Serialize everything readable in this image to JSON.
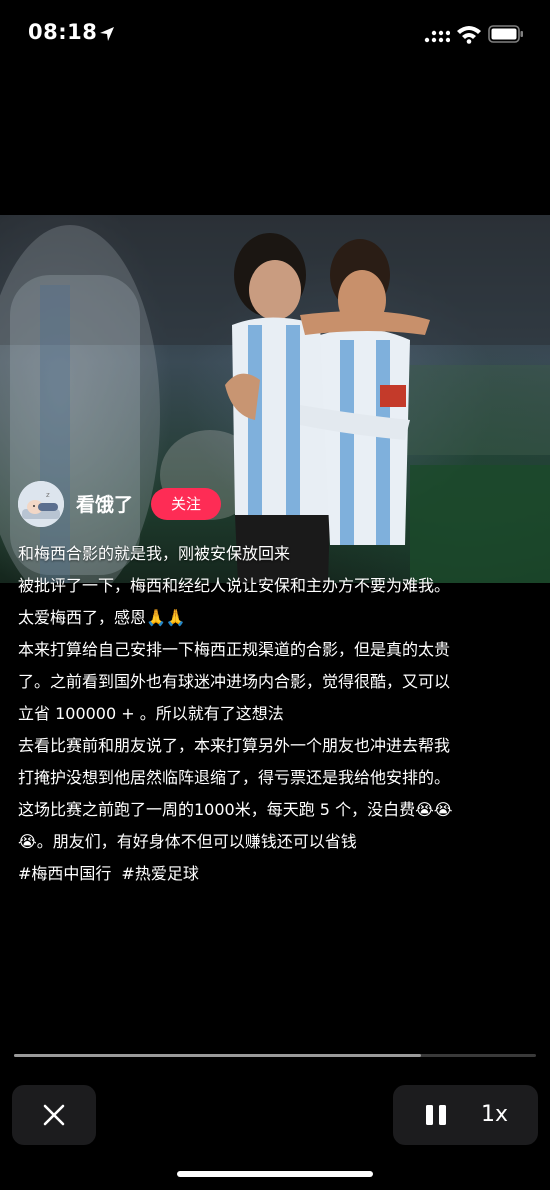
{
  "status_bar": {
    "time": "08:18",
    "icons": [
      "location-arrow-icon",
      "cellular-signal-icon",
      "wifi-icon",
      "battery-icon"
    ]
  },
  "author": {
    "name": "看饿了",
    "follow_label": "关注"
  },
  "caption": {
    "lines": [
      "和梅西合影的就是我，刚被安保放回来",
      "被批评了一下，梅西和经纪人说让安保和主办方不要为难我。",
      "太爱梅西了，感恩🙏🙏",
      "本来打算给自己安排一下梅西正规渠道的合影，但是真的太贵",
      "了。之前看到国外也有球迷冲进场内合影，觉得很酷，又可以",
      "立省 100000 + 。所以就有了这想法",
      "去看比赛前和朋友说了，本来打算另外一个朋友也冲进去帮我",
      "打掩护没想到他居然临阵退缩了，得亏票还是我给他安排的。",
      "这场比赛之前跑了一周的1000米，每天跑 5 个，没白费😭😭",
      "😭。朋友们，有好身体不但可以赚钱还可以省钱"
    ],
    "hashtags": [
      "#梅西中国行",
      "#热爱足球"
    ]
  },
  "playback": {
    "progress": 0.78,
    "speed_label": "1x"
  },
  "colors": {
    "accent": "#fe2c55",
    "control_bg": "#1c1c1e"
  }
}
